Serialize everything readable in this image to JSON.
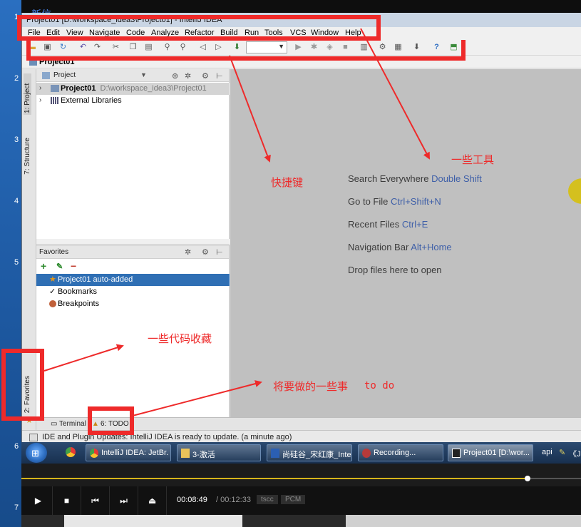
{
  "desktop": {
    "numbers": [
      "1",
      "2",
      "3",
      "4",
      "5",
      "6",
      "7"
    ],
    "title_fragment": "新信"
  },
  "window": {
    "title": "Project01 [D:\\workspace_idea3\\Project01] - IntelliJ IDEA"
  },
  "menu": [
    "File",
    "Edit",
    "View",
    "Navigate",
    "Code",
    "Analyze",
    "Refactor",
    "Build",
    "Run",
    "Tools",
    "VCS",
    "Window",
    "Help"
  ],
  "toolbar": {
    "icons": [
      "open-icon",
      "save-icon",
      "sync-icon",
      "undo-icon",
      "redo-icon",
      "cut-icon",
      "copy-icon",
      "paste-icon",
      "find-icon",
      "replace-icon",
      "back-icon",
      "forward-icon",
      "make-icon",
      "run-icon",
      "debug-icon",
      "coverage-icon",
      "stop-icon",
      "sdk-icon",
      "settings-icon",
      "structure-icon",
      "vcs-icon",
      "help-icon",
      "update-icon"
    ],
    "run_config_value": ""
  },
  "navbar": {
    "crumb": "Project01"
  },
  "side_tabs": {
    "project": "1: Project",
    "structure": "7: Structure",
    "favorites": "2: Favorites"
  },
  "project_panel": {
    "header": "Project",
    "tree": [
      {
        "label": "Project01",
        "path": "D:\\workspace_idea3\\Project01",
        "selected": true
      },
      {
        "label": "External Libraries",
        "path": "",
        "selected": false
      }
    ]
  },
  "favorites_panel": {
    "header": "Favorites",
    "items": [
      {
        "label": "Project01  auto-added",
        "selected": true
      },
      {
        "label": "Bookmarks",
        "selected": false
      },
      {
        "label": "Breakpoints",
        "selected": false
      }
    ]
  },
  "editor_hints": [
    {
      "text": "Search Everywhere",
      "key": "Double Shift"
    },
    {
      "text": "Go to File",
      "key": "Ctrl+Shift+N"
    },
    {
      "text": "Recent Files",
      "key": "Ctrl+E"
    },
    {
      "text": "Navigation Bar",
      "key": "Alt+Home"
    },
    {
      "text": "Drop files here to open",
      "key": ""
    }
  ],
  "bottom_tabs": {
    "terminal": "Terminal",
    "todo": "6: TODO"
  },
  "status": {
    "text": "IDE and Plugin Updates: IntelliJ IDEA is ready to update. (a minute ago)"
  },
  "taskbar": {
    "tasks": [
      {
        "label": "IntelliJ IDEA: JetBr..."
      },
      {
        "label": "3-激活"
      },
      {
        "label": "尚硅谷_宋红康_Inte..."
      },
      {
        "label": "Recording..."
      },
      {
        "label": "Project01 [D:\\wor..."
      }
    ],
    "tray": [
      "api",
      "《Ja"
    ]
  },
  "player": {
    "progress": 0.904,
    "time_current": "00:08:49",
    "time_separator": "/",
    "time_total": "00:12:33",
    "codecs": [
      "tscc",
      "PCM"
    ]
  },
  "annotations": {
    "shortcuts": "快捷键",
    "tools": "一些工具",
    "favorites": "一些代码收藏",
    "todo_label": "将要做的一些事",
    "todo_en": "to do"
  },
  "colors": {
    "annotation": "#ee2a2a",
    "selection": "#2f6fb4",
    "hint_key": "#3e5fa8",
    "progress": "#d7b51a"
  }
}
